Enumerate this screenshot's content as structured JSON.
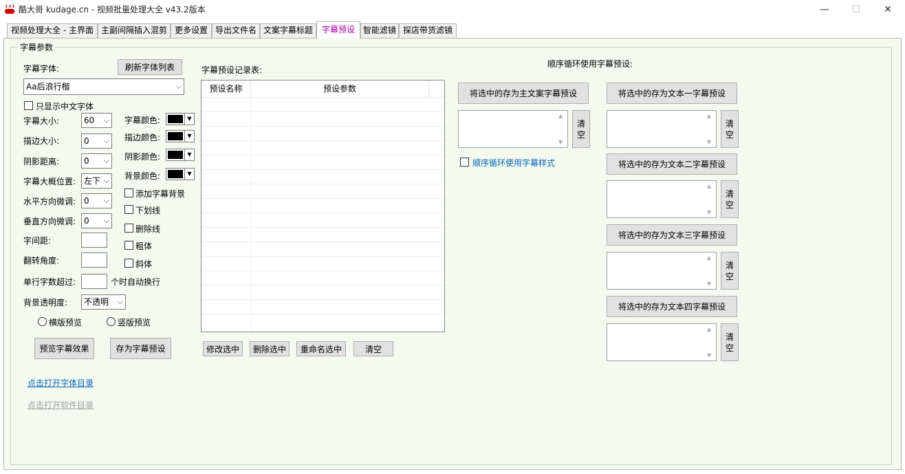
{
  "window": {
    "title": "酷大哥 kudage.cn -  视频批量处理大全  v43.2版本",
    "minimize": "—",
    "maximize": "☐",
    "close": "✕"
  },
  "tabs": [
    {
      "label": "视频处理大全 - 主界面"
    },
    {
      "label": "主副间隔插入混剪"
    },
    {
      "label": "更多设置"
    },
    {
      "label": "导出文件名"
    },
    {
      "label": "文案字幕标题"
    },
    {
      "label": "字幕预设"
    },
    {
      "label": "智能滤镜"
    },
    {
      "label": "探店带货滤镜"
    }
  ],
  "active_tab": "字幕预设",
  "group": {
    "title": "字幕参数"
  },
  "font": {
    "label": "字幕字体:",
    "refresh_button": "刷新字体列表",
    "selected": "Aa后浪行楷",
    "only_chinese": "只显示中文字体"
  },
  "params": {
    "size_label": "字幕大小:",
    "size_value": "60",
    "stroke_label": "描边大小:",
    "stroke_value": "0",
    "shadow_label": "阴影距离:",
    "shadow_value": "0",
    "position_label": "字幕大概位置:",
    "position_value": "左下",
    "hoffset_label": "水平方向微调:",
    "hoffset_value": "0",
    "voffset_label": "垂直方向微调:",
    "voffset_value": "0",
    "spacing_label": "字间距:",
    "rotate_label": "翻转角度:",
    "wrap_label": "单行字数超过:",
    "wrap_suffix": "个时自动换行",
    "bg_opacity_label": "背景透明度:",
    "bg_opacity_value": "不透明"
  },
  "colors": {
    "font_color_label": "字幕颜色:",
    "stroke_color_label": "描边颜色:",
    "shadow_color_label": "阴影颜色:",
    "bg_color_label": "背景颜色:",
    "swatch": "#000000"
  },
  "checks": {
    "add_bg": "添加字幕背景",
    "underline": "下划线",
    "strikeout": "删除线",
    "bold": "粗体",
    "italic": "斜体"
  },
  "preview": {
    "horizontal": "横版预览",
    "vertical": "竖版预览",
    "preview_button": "预览字幕效果",
    "save_button": "存为字幕预设"
  },
  "links": {
    "font_dir": "点击打开字体目录",
    "app_dir": "点击打开软件目录"
  },
  "presets": {
    "list_title": "字幕预设记录表:",
    "col_name": "预设名称",
    "col_params": "预设参数",
    "modify": "修改选中",
    "delete": "删除选中",
    "rename": "重命名选中",
    "clear": "清空"
  },
  "cycle": {
    "title": "顺序循环使用字幕预设:",
    "main_button": "将选中的存为主文案字幕预设",
    "cycle_style": "顺序循环使用字幕样式",
    "text1_button": "将选中的存为文本一字幕预设",
    "text2_button": "将选中的存为文本二字幕预设",
    "text3_button": "将选中的存为文本三字幕预设",
    "text4_button": "将选中的存为文本四字幕预设",
    "clear_label": "清空"
  },
  "accent_colors": {
    "active_tab": "#c800c8",
    "link": "#0066cc",
    "panel": "#f4fbee"
  }
}
